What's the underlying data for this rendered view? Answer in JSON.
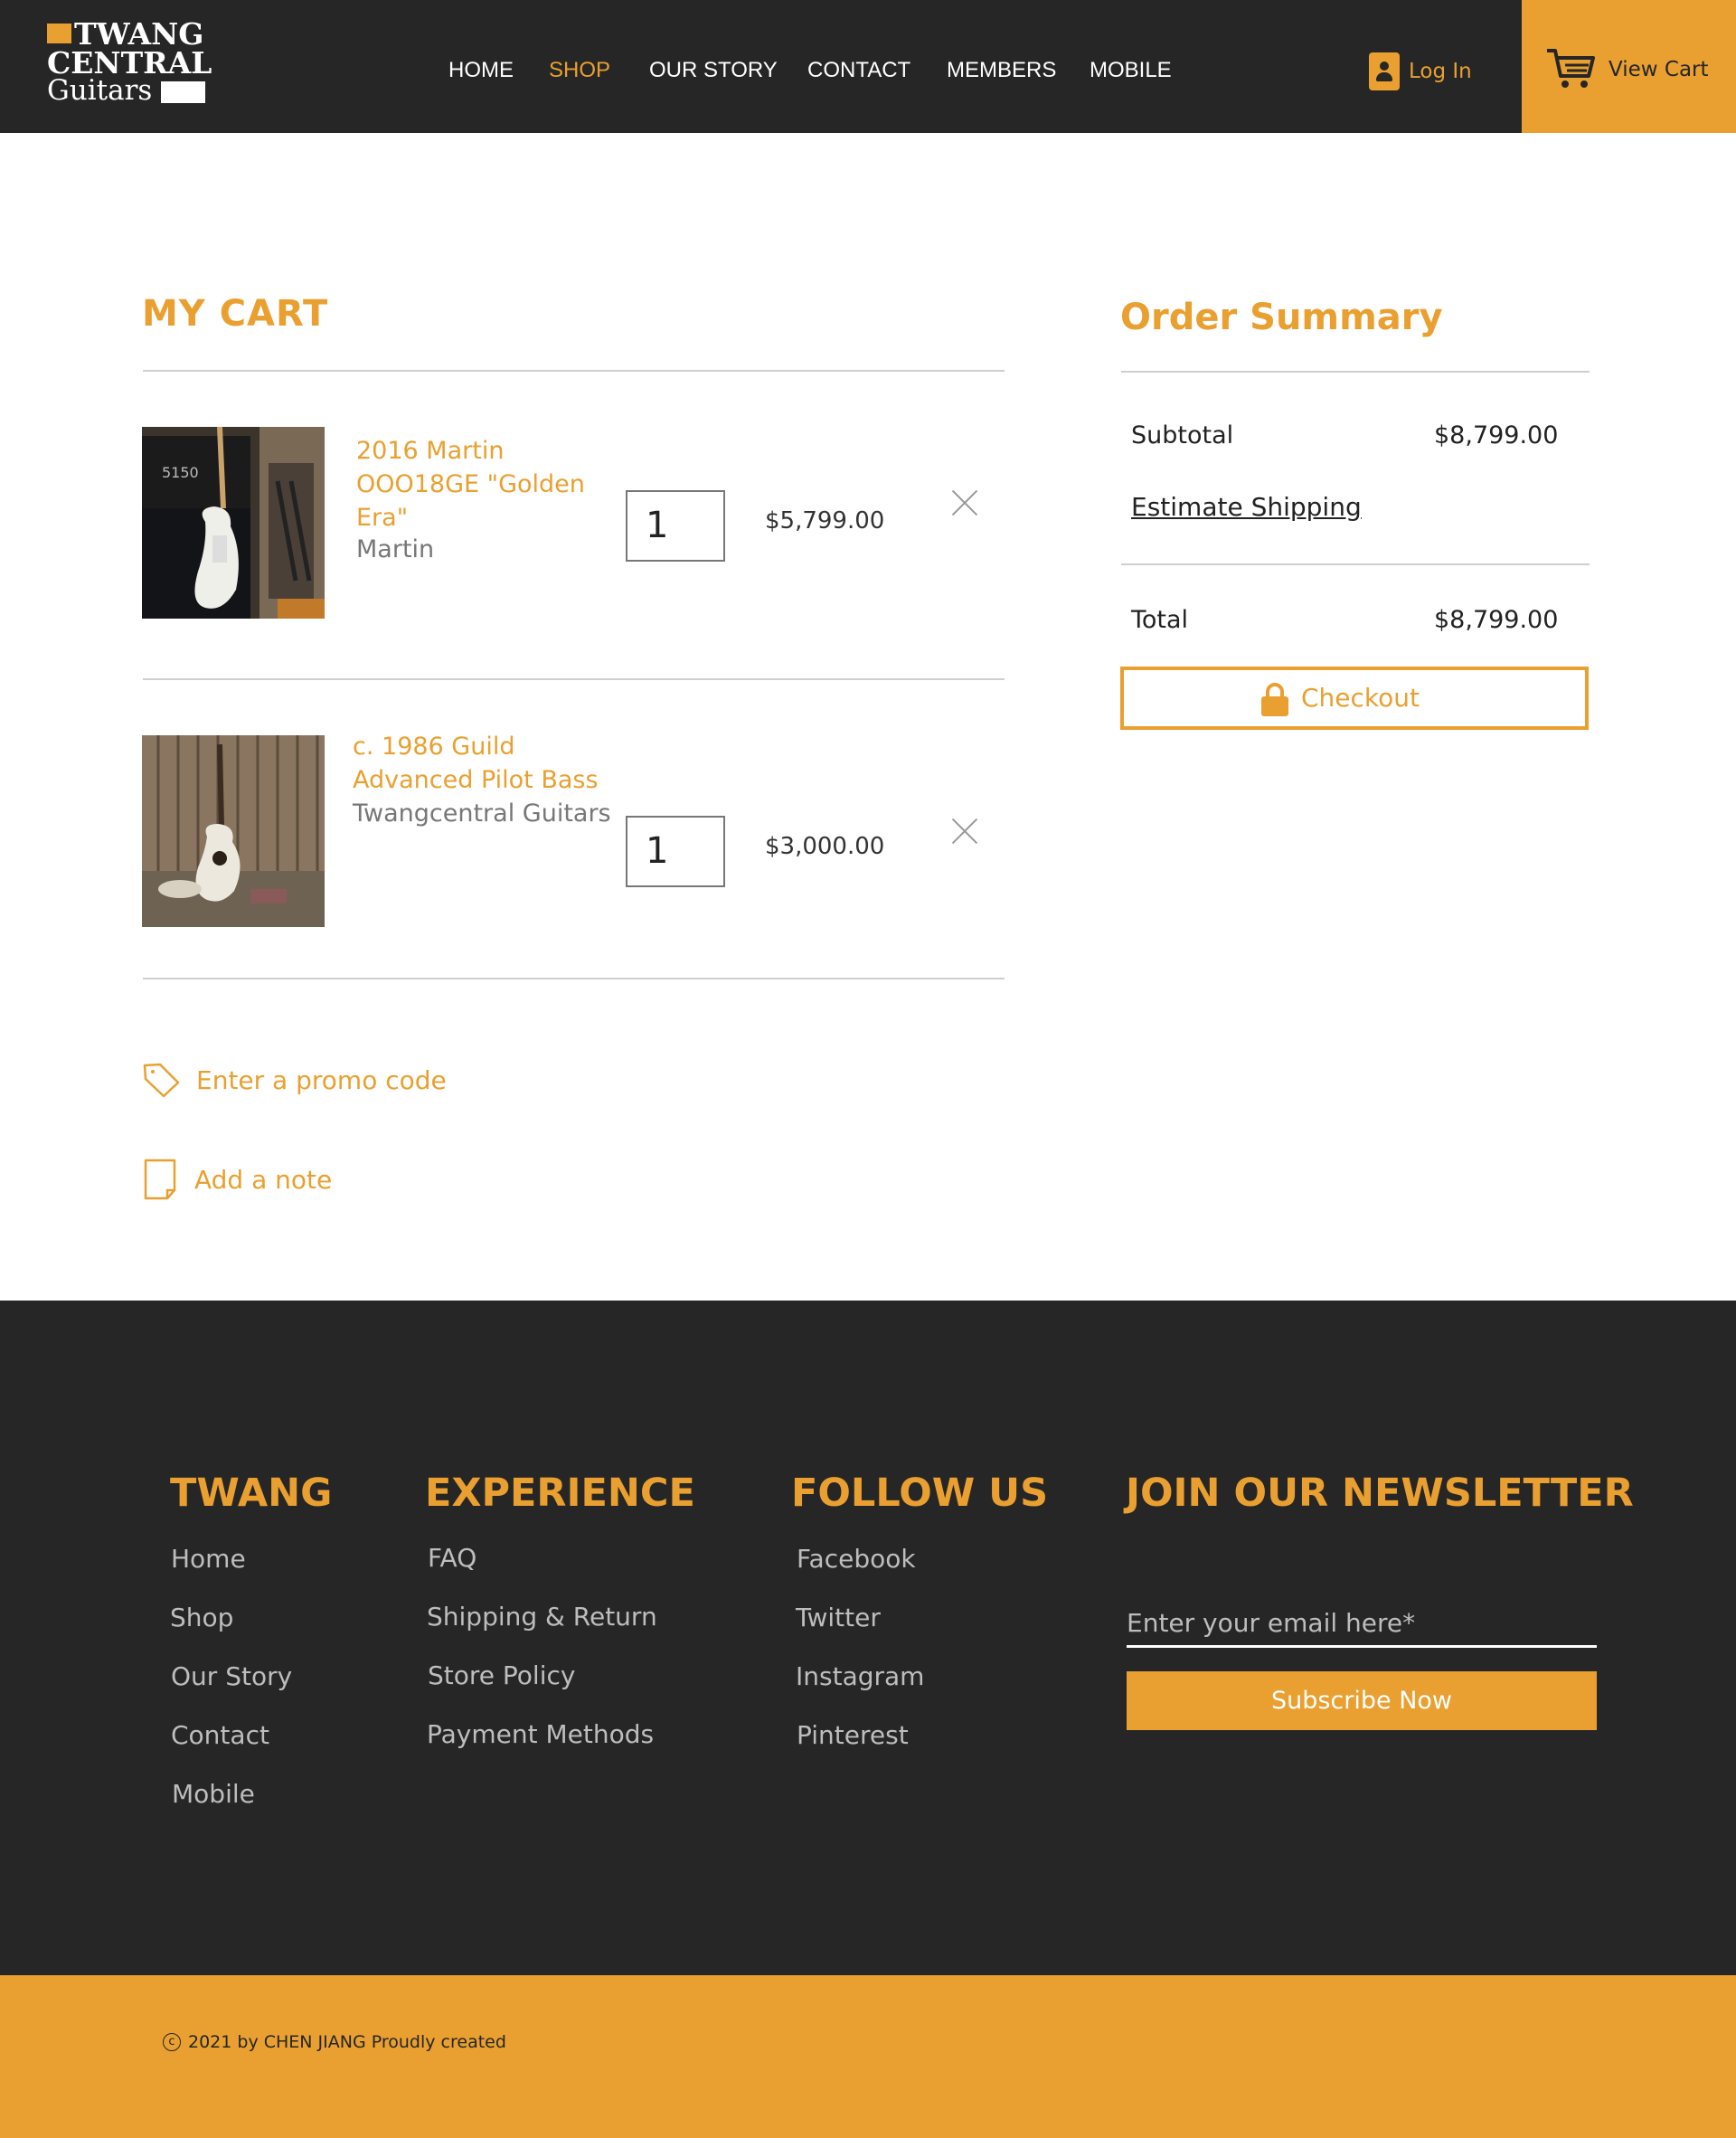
{
  "brand": {
    "line1": "TWANG",
    "line2": "CENTRAL",
    "line3": "Guitars"
  },
  "nav": [
    {
      "label": "HOME"
    },
    {
      "label": "SHOP"
    },
    {
      "label": "OUR STORY"
    },
    {
      "label": "CONTACT"
    },
    {
      "label": "MEMBERS"
    },
    {
      "label": "MOBILE"
    }
  ],
  "header": {
    "login_label": "Log In",
    "cart_label": "View Cart"
  },
  "cart": {
    "title": "MY CART",
    "items": [
      {
        "name_lines": [
          "2016 Martin",
          "OOO18GE \"Golden",
          "Era\""
        ],
        "brand": "Martin",
        "quantity": "1",
        "price": "$5,799.00"
      },
      {
        "name_lines": [
          "c. 1986 Guild",
          "Advanced Pilot Bass"
        ],
        "brand": "Twangcentral Guitars",
        "quantity": "1",
        "price": "$3,000.00"
      }
    ],
    "promo_label": "Enter a promo code",
    "note_label": "Add a note"
  },
  "summary": {
    "title": "Order Summary",
    "subtotal_label": "Subtotal",
    "subtotal_value": "$8,799.00",
    "shipping_label": "Estimate Shipping",
    "total_label": "Total",
    "total_value": "$8,799.00",
    "checkout_label": "Checkout"
  },
  "footer": {
    "col1": {
      "title": "TWANG",
      "links": [
        "Home",
        "Shop",
        "Our Story",
        "Contact",
        "Mobile"
      ]
    },
    "col2": {
      "title": "EXPERIENCE",
      "links": [
        "FAQ",
        "Shipping & Return",
        "Store Policy",
        "Payment Methods"
      ]
    },
    "col3": {
      "title": "FOLLOW US",
      "links": [
        "Facebook",
        "Twitter",
        "Instagram",
        "Pinterest"
      ]
    },
    "col4": {
      "title": "JOIN OUR NEWSLETTER",
      "email_placeholder": "Enter your email here*",
      "subscribe_label": "Subscribe Now"
    },
    "copyright": "2021 by CHEN JIANG Proudly created"
  },
  "colors": {
    "accent": "#e9a030",
    "dark": "#262626"
  }
}
